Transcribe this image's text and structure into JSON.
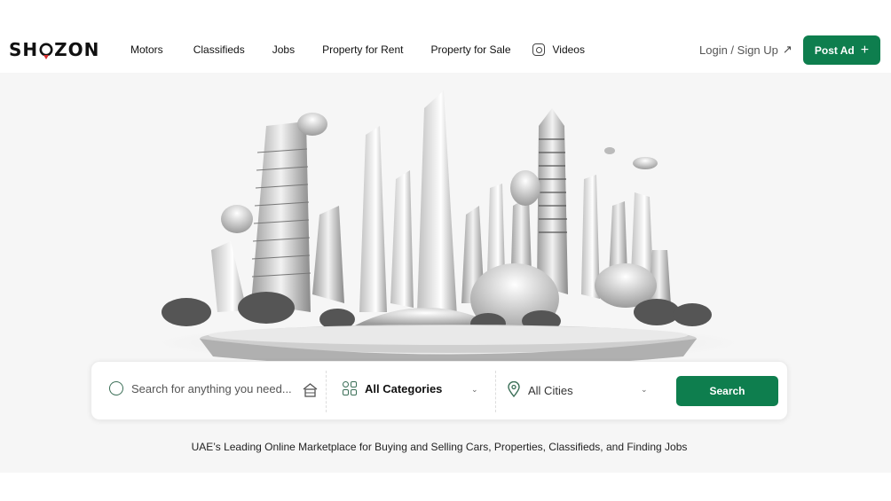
{
  "brand": {
    "logo_text_left": "SH",
    "logo_text_right": "ZON"
  },
  "nav": {
    "items": [
      {
        "label": "Motors"
      },
      {
        "label": "Classifieds"
      },
      {
        "label": "Jobs"
      },
      {
        "label": "Property for Rent"
      },
      {
        "label": "Property for Sale"
      },
      {
        "label": "Videos",
        "icon": "video-icon"
      }
    ]
  },
  "header": {
    "login_label": "Login / Sign Up",
    "login_icon": "arrow-up-right-icon",
    "post_ad_label": "Post Ad",
    "post_ad_icon": "plus-icon"
  },
  "search": {
    "placeholder": "Search for anything you need...",
    "category_value": "All Categories",
    "city_value": "All Cities",
    "button_label": "Search"
  },
  "tagline": "UAE’s Leading Online Marketplace for Buying and Selling Cars, Properties, Classifieds, and Finding Jobs",
  "colors": {
    "brand_green": "#0e7e4e",
    "pin_red": "#d62e2e"
  }
}
